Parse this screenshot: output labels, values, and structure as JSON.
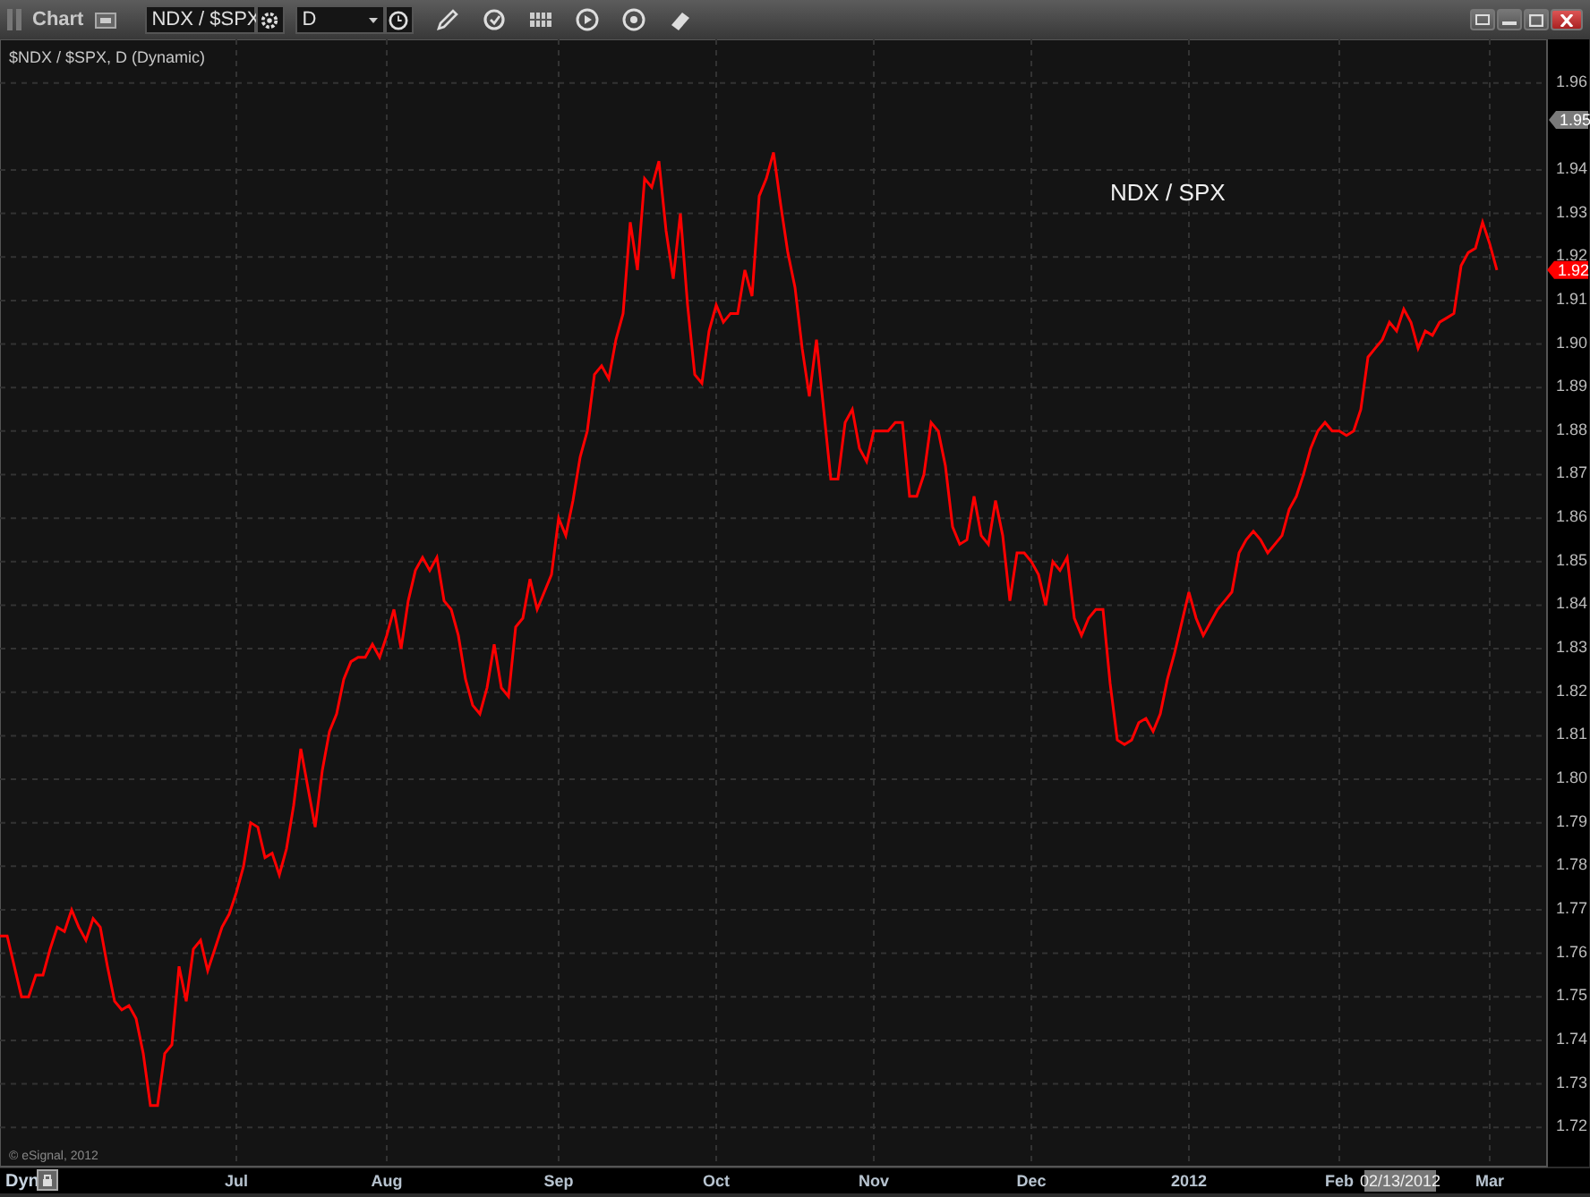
{
  "toolbar": {
    "title": "Chart",
    "symbol": "NDX / $SPX",
    "interval": "D"
  },
  "chart": {
    "legend": "$NDX / $SPX, D (Dynamic)",
    "copyright": "© eSignal, 2012",
    "cursor_date": "02/13/2012",
    "mode": "Dyn",
    "last_price": "1.92",
    "cursor_price": "1.95",
    "chart_data": {
      "type": "line",
      "grid": true,
      "categories": [
        null,
        null,
        null,
        null,
        null,
        null,
        null,
        null,
        null,
        null,
        null,
        null,
        null,
        null,
        null,
        null,
        null,
        null,
        null,
        null,
        null,
        null,
        null,
        null,
        null,
        null,
        null,
        null,
        null,
        null,
        null,
        null,
        null,
        "Jul",
        null,
        null,
        null,
        null,
        null,
        null,
        null,
        null,
        null,
        null,
        null,
        null,
        null,
        null,
        null,
        null,
        null,
        null,
        null,
        null,
        "Aug",
        null,
        null,
        null,
        null,
        null,
        null,
        null,
        null,
        null,
        null,
        null,
        null,
        null,
        null,
        null,
        null,
        null,
        null,
        null,
        null,
        null,
        null,
        null,
        "Sep",
        null,
        null,
        null,
        null,
        null,
        null,
        null,
        null,
        null,
        null,
        null,
        null,
        null,
        null,
        null,
        null,
        null,
        null,
        null,
        null,
        null,
        "Oct",
        null,
        null,
        null,
        null,
        null,
        null,
        null,
        null,
        null,
        null,
        null,
        null,
        null,
        null,
        null,
        null,
        null,
        null,
        null,
        null,
        null,
        "Nov",
        null,
        null,
        null,
        null,
        null,
        null,
        null,
        null,
        null,
        null,
        null,
        null,
        null,
        null,
        null,
        null,
        null,
        null,
        null,
        null,
        null,
        "Dec",
        null,
        null,
        null,
        null,
        null,
        null,
        null,
        null,
        null,
        null,
        null,
        null,
        null,
        null,
        null,
        null,
        null,
        null,
        null,
        null,
        null,
        "2012",
        null,
        null,
        null,
        null,
        null,
        null,
        null,
        null,
        null,
        null,
        null,
        null,
        null,
        null,
        null,
        null,
        null,
        null,
        null,
        null,
        "Feb",
        null,
        null,
        null,
        null,
        null,
        null,
        null,
        null,
        null,
        null,
        null,
        null,
        null,
        null,
        null,
        null,
        null,
        null,
        null,
        null,
        "Mar",
        null
      ],
      "ylim": [
        1.711,
        1.97
      ],
      "yticks": [
        1.72,
        1.73,
        1.74,
        1.75,
        1.76,
        1.77,
        1.78,
        1.79,
        {
          "value": 1.8,
          "label": "1.80"
        },
        1.81,
        1.82,
        1.83,
        1.84,
        1.85,
        1.86,
        1.87,
        1.88,
        1.89,
        {
          "value": 1.9,
          "label": "1.90"
        },
        1.91,
        1.92,
        1.93,
        1.94,
        1.96
      ],
      "series": [
        {
          "name": "NDX / SPX",
          "color": "#ff0000",
          "values": [
            1.764,
            1.764,
            1.757,
            1.75,
            1.75,
            1.755,
            1.755,
            1.761,
            1.766,
            1.765,
            1.77,
            1.766,
            1.763,
            1.768,
            1.766,
            1.757,
            1.749,
            1.747,
            1.748,
            1.745,
            1.737,
            1.725,
            1.725,
            1.737,
            1.739,
            1.757,
            1.749,
            1.761,
            1.763,
            1.756,
            1.761,
            1.766,
            1.769,
            1.774,
            1.78,
            1.79,
            1.789,
            1.782,
            1.783,
            1.778,
            1.784,
            1.794,
            1.807,
            1.798,
            1.789,
            1.802,
            1.811,
            1.815,
            1.823,
            1.827,
            1.828,
            1.828,
            1.831,
            1.828,
            1.833,
            1.839,
            1.83,
            1.841,
            1.848,
            1.851,
            1.848,
            1.851,
            1.841,
            1.839,
            1.833,
            1.823,
            1.817,
            1.815,
            1.821,
            1.831,
            1.821,
            1.819,
            1.835,
            1.837,
            1.846,
            1.839,
            1.843,
            1.847,
            1.86,
            1.856,
            1.864,
            1.874,
            1.88,
            1.893,
            1.895,
            1.892,
            1.901,
            1.907,
            1.928,
            1.917,
            1.938,
            1.936,
            1.942,
            1.926,
            1.915,
            1.93,
            1.909,
            1.893,
            1.891,
            1.903,
            1.909,
            1.905,
            1.907,
            1.907,
            1.917,
            1.911,
            1.934,
            1.938,
            1.944,
            1.932,
            1.921,
            1.913,
            1.899,
            1.888,
            1.901,
            1.885,
            1.869,
            1.869,
            1.882,
            1.885,
            1.876,
            1.873,
            1.88,
            1.88,
            1.88,
            1.882,
            1.882,
            1.865,
            1.865,
            1.87,
            1.882,
            1.88,
            1.872,
            1.858,
            1.854,
            1.855,
            1.865,
            1.856,
            1.854,
            1.864,
            1.856,
            1.841,
            1.852,
            1.852,
            1.85,
            1.847,
            1.84,
            1.85,
            1.848,
            1.851,
            1.837,
            1.833,
            1.837,
            1.839,
            1.839,
            1.822,
            1.809,
            1.808,
            1.809,
            1.813,
            1.814,
            1.811,
            1.815,
            1.823,
            1.829,
            1.836,
            1.843,
            1.837,
            1.833,
            1.836,
            1.839,
            1.841,
            1.843,
            1.852,
            1.855,
            1.857,
            1.855,
            1.852,
            1.854,
            1.856,
            1.862,
            1.865,
            1.87,
            1.876,
            1.88,
            1.882,
            1.88,
            1.88,
            1.879,
            1.88,
            1.885,
            1.897,
            1.899,
            1.901,
            1.905,
            1.903,
            1.908,
            1.905,
            1.899,
            1.903,
            1.902,
            1.905,
            1.906,
            1.907,
            1.918,
            1.921,
            1.922,
            1.928,
            1.923,
            1.917
          ]
        }
      ]
    }
  }
}
